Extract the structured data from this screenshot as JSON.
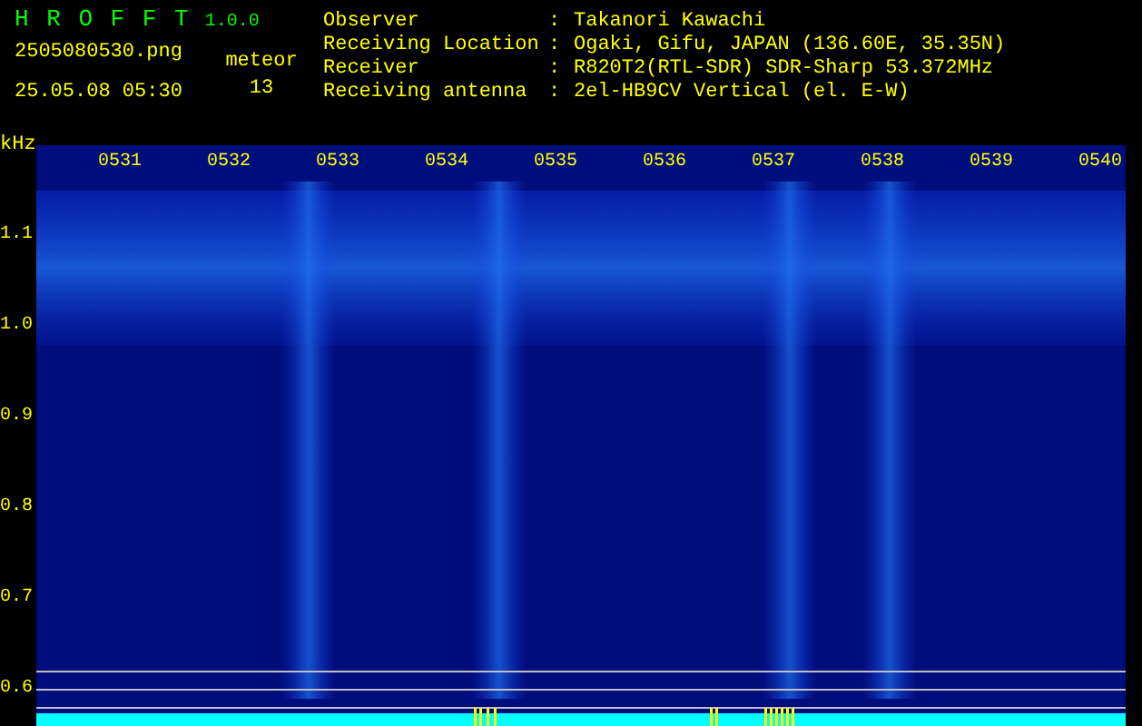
{
  "header": {
    "title": "H R O F F T",
    "version": "1.0.0",
    "filename": "2505080530.png",
    "datetime": "25.05.08 05:30",
    "meteor_label": "meteor",
    "meteor_count": "13"
  },
  "info": [
    {
      "label": "Observer",
      "separator": ":",
      "value": "Takanori Kawachi"
    },
    {
      "label": "Receiving Location",
      "separator": ":",
      "value": "Ogaki, Gifu, JAPAN (136.60E, 35.35N)"
    },
    {
      "label": "Receiver",
      "separator": ":",
      "value": "R820T2(RTL-SDR) SDR-Sharp 53.372MHz"
    },
    {
      "label": "Receiving antenna",
      "separator": ":",
      "value": "2el-HB9CV Vertical (el. E-W)"
    }
  ],
  "spectrogram": {
    "unit": "kHz",
    "y_labels": [
      "1.1",
      "1.0",
      "0.9",
      "0.8",
      "0.7",
      "0.6"
    ],
    "time_labels": [
      "0531",
      "0532",
      "0533",
      "0534",
      "0535",
      "0536",
      "0537",
      "0538",
      "0539",
      "0540"
    ]
  }
}
